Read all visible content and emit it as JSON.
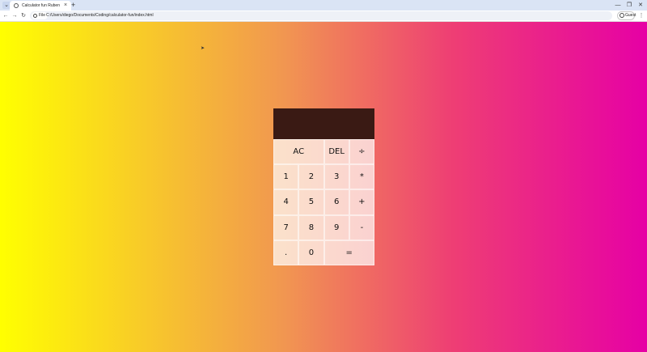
{
  "browser": {
    "tab_title": "Calculator fun Ruben",
    "tab_close": "×",
    "new_tab": "+",
    "tab_menu": "⌄",
    "window_controls": {
      "minimize": "—",
      "restore": "❐",
      "close": "✕"
    },
    "nav": {
      "back": "←",
      "forward": "→",
      "reload": "↻"
    },
    "file_chip": "File",
    "url": "C:/Users/diego/Documents/Coding/calculator-fun/index.html",
    "guest_label": "Guest",
    "menu": "⋮"
  },
  "calculator": {
    "display_value": "",
    "keys": {
      "clear": "AC",
      "delete": "DEL",
      "divide": "÷",
      "one": "1",
      "two": "2",
      "three": "3",
      "multiply": "*",
      "four": "4",
      "five": "5",
      "six": "6",
      "add": "+",
      "seven": "7",
      "eight": "8",
      "nine": "9",
      "subtract": "-",
      "decimal": ".",
      "zero": "0",
      "equals": "="
    }
  },
  "colors": {
    "gradient_left": "#ffff00",
    "gradient_mid": "#f19651",
    "gradient_right": "#e600a5",
    "display_bg": "#3a1a14"
  }
}
